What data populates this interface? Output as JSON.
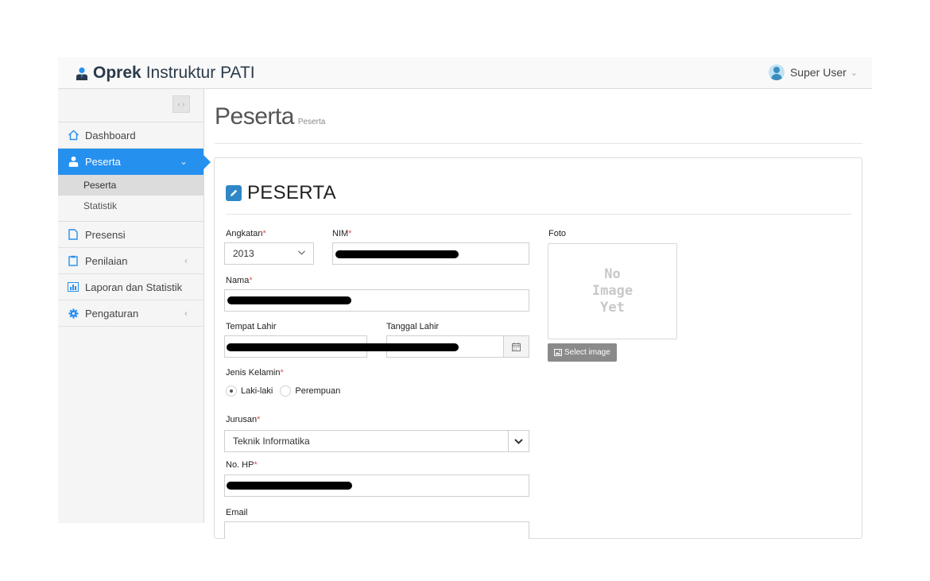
{
  "header": {
    "brand_bold": "Oprek",
    "brand_rest": "Instruktur PATI",
    "brand_icon": "user-tie-icon",
    "user_name": "Super User",
    "user_chevron": "⌄"
  },
  "sidebar": {
    "collapse_icon": "‹ ›",
    "items": [
      {
        "label": "Dashboard",
        "icon": "home-icon",
        "arrow": ""
      },
      {
        "label": "Peserta",
        "icon": "user-tie-icon",
        "arrow": "⌄",
        "active": true,
        "submenu": [
          {
            "label": "Peserta",
            "current": true
          },
          {
            "label": "Statistik"
          }
        ]
      },
      {
        "label": "Presensi",
        "icon": "file-icon",
        "arrow": ""
      },
      {
        "label": "Penilaian",
        "icon": "clipboard-icon",
        "arrow": "‹"
      },
      {
        "label": "Laporan dan Statistik",
        "icon": "bar-chart-icon",
        "arrow": ""
      },
      {
        "label": "Pengaturan",
        "icon": "gear-icon",
        "arrow": "‹"
      }
    ]
  },
  "page": {
    "title": "Peserta",
    "subtitle": "Peserta"
  },
  "form": {
    "heading": "PESERTA",
    "heading_icon": "pencil-icon",
    "angkatan": {
      "label": "Angkatan",
      "required": "*",
      "value": "2013"
    },
    "nim": {
      "label": "NIM",
      "required": "*",
      "value": "[redacted]"
    },
    "nama": {
      "label": "Nama",
      "required": "*",
      "value": "[redacted]"
    },
    "tempat_lahir": {
      "label": "Tempat Lahir",
      "value": "[redacted]"
    },
    "tanggal_lahir": {
      "label": "Tanggal Lahir",
      "value": "[redacted]",
      "icon": "calendar-icon"
    },
    "jenis_kelamin": {
      "label": "Jenis Kelamin",
      "required": "*",
      "options": [
        {
          "label": "Laki-laki",
          "checked": true
        },
        {
          "label": "Perempuan",
          "checked": false
        }
      ]
    },
    "jurusan": {
      "label": "Jurusan",
      "required": "*",
      "value": "Teknik Informatika"
    },
    "no_hp": {
      "label": "No. HP",
      "required": "*",
      "value": "[redacted]"
    },
    "email": {
      "label": "Email",
      "value": ""
    },
    "foto": {
      "label": "Foto",
      "placeholder_lines": [
        "No",
        "Image",
        "Yet"
      ],
      "button_label": "Select image",
      "button_icon": "image-icon"
    }
  },
  "colors": {
    "accent": "#2690ef",
    "brand_text": "#2b3a4a",
    "required": "#d9534f",
    "redaction": "#000000"
  }
}
